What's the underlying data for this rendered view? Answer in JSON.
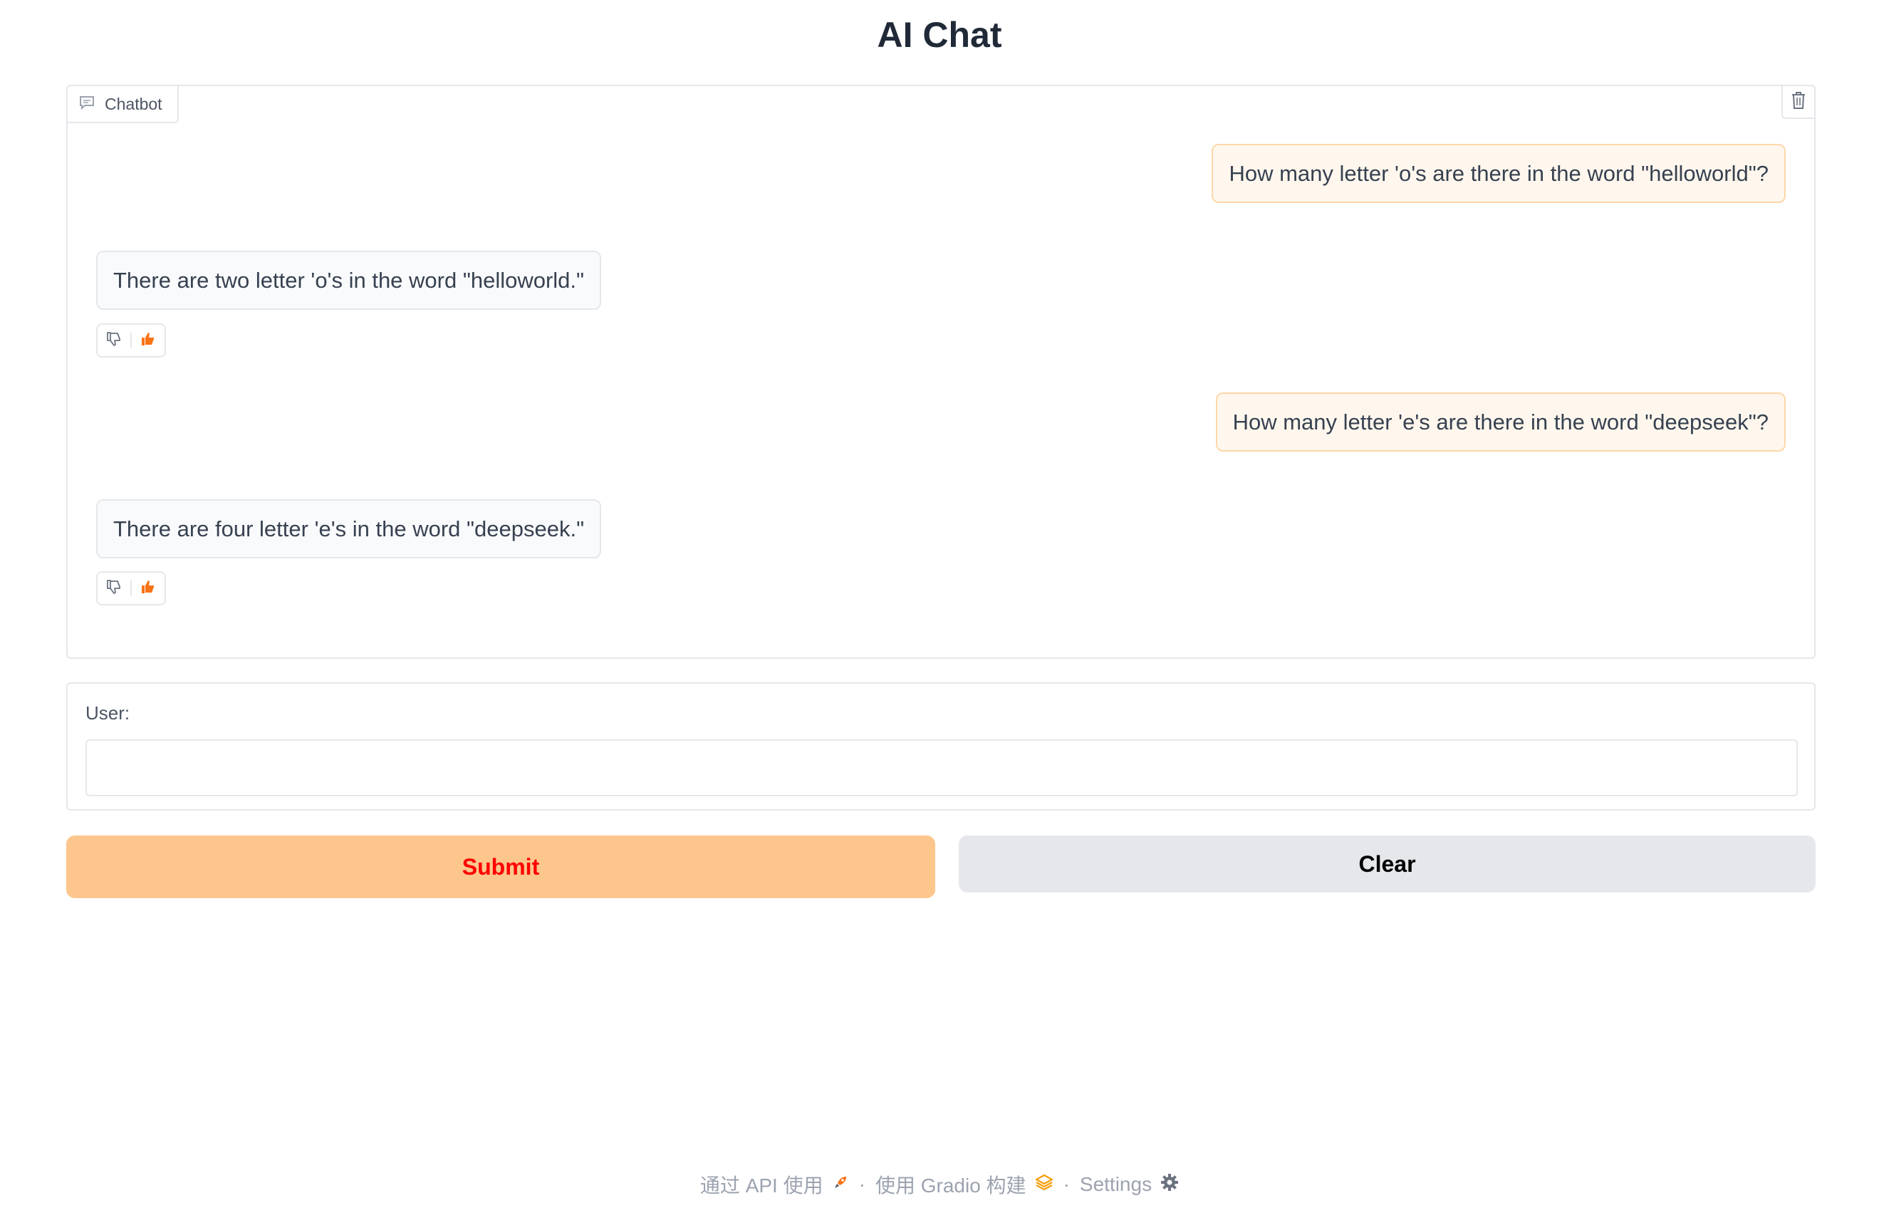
{
  "page": {
    "title": "AI Chat"
  },
  "chatbot": {
    "label": "Chatbot",
    "messages": [
      {
        "role": "user",
        "text": "How many letter 'o's are there in the word \"helloworld\"?"
      },
      {
        "role": "bot",
        "text": "There are two letter 'o's in the word \"helloworld.\""
      },
      {
        "role": "user",
        "text": "How many letter 'e's are there in the word \"deepseek\"?"
      },
      {
        "role": "bot",
        "text": "There are four letter 'e's in the word \"deepseek.\""
      }
    ]
  },
  "input": {
    "label": "User:",
    "value": "",
    "placeholder": ""
  },
  "buttons": {
    "submit": "Submit",
    "clear": "Clear"
  },
  "footer": {
    "api_link": "通过 API 使用",
    "gradio_link": "使用 Gradio 构建",
    "settings_link": "Settings",
    "separator": "·"
  },
  "colors": {
    "accent": "#f97316",
    "submit_bg": "#fdc68d",
    "submit_text": "#ff0000",
    "user_bubble": "#fff7ed"
  }
}
